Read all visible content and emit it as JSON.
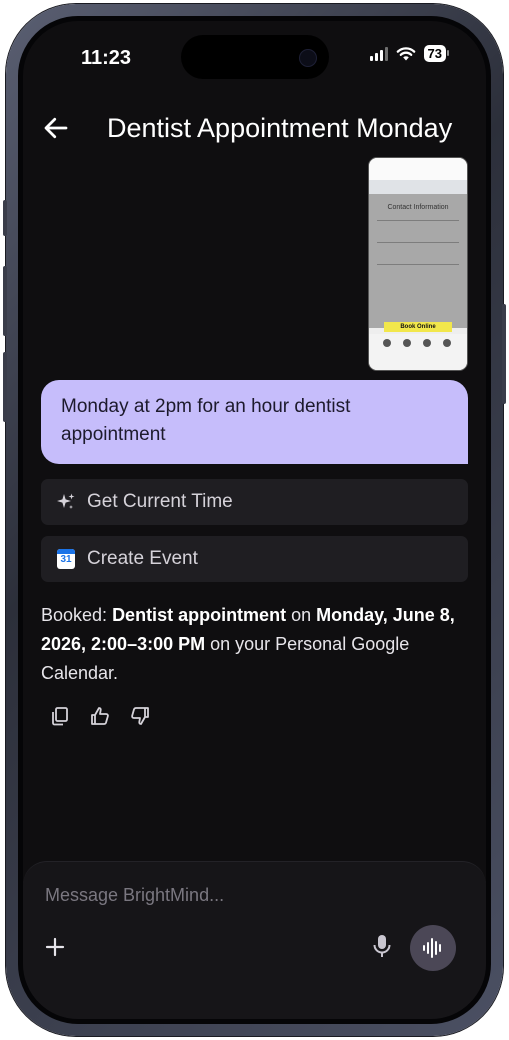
{
  "status_bar": {
    "time": "11:23",
    "battery": "73"
  },
  "header": {
    "title": "Dentist Appointment Monday"
  },
  "attachment": {
    "heading": "Contact Information",
    "button": "Book Online"
  },
  "conversation": {
    "user_message": "Monday at 2pm for an hour dentist appointment",
    "tool_calls": [
      {
        "label": "Get Current Time",
        "icon": "sparkle-icon"
      },
      {
        "label": "Create Event",
        "icon": "calendar-icon",
        "icon_text": "31"
      }
    ],
    "response": {
      "prefix": "Booked: ",
      "event": "Dentist appointment",
      "mid": " on ",
      "when": "Monday, June 8, 2026, 2:00–3:00 PM",
      "suffix": " on your Personal Google Calendar."
    }
  },
  "composer": {
    "placeholder": "Message BrightMind..."
  },
  "colors": {
    "user_bubble": "#c6bdfb",
    "background": "#0f0e10",
    "card": "#1f1e22",
    "voice_button": "#4b4756"
  }
}
